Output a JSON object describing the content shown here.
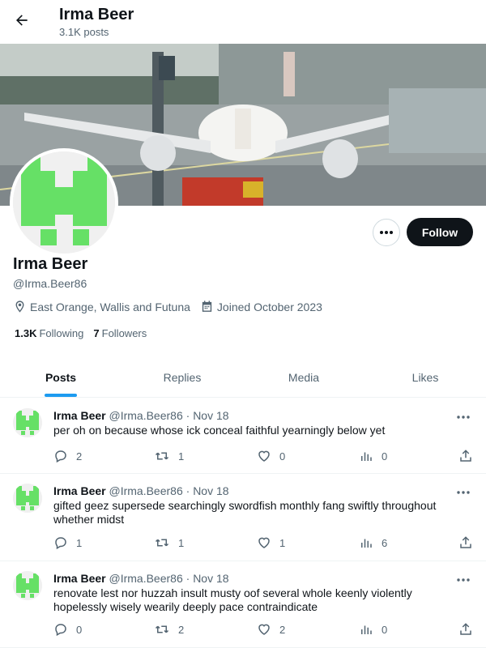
{
  "topbar": {
    "title": "Irma Beer",
    "post_count": "3.1K posts"
  },
  "profile": {
    "name": "Irma Beer",
    "handle": "@Irma.Beer86",
    "location": "East Orange, Wallis and Futuna",
    "joined": "Joined October 2023",
    "following_count": "1.3K",
    "following_label": "Following",
    "followers_count": "7",
    "followers_label": "Followers",
    "follow_label": "Follow",
    "avatar_color": "#66e066"
  },
  "tabs": [
    {
      "label": "Posts",
      "active": true
    },
    {
      "label": "Replies",
      "active": false
    },
    {
      "label": "Media",
      "active": false
    },
    {
      "label": "Likes",
      "active": false
    }
  ],
  "posts": [
    {
      "name": "Irma Beer",
      "handle": "@Irma.Beer86",
      "date": "Nov 18",
      "text": "per oh on because whose ick conceal faithful yearningly below yet",
      "replies": "2",
      "reposts": "1",
      "likes": "0",
      "views": "0"
    },
    {
      "name": "Irma Beer",
      "handle": "@Irma.Beer86",
      "date": "Nov 18",
      "text": "gifted geez supersede searchingly swordfish monthly fang swiftly throughout whether midst",
      "replies": "1",
      "reposts": "1",
      "likes": "1",
      "views": "6"
    },
    {
      "name": "Irma Beer",
      "handle": "@Irma.Beer86",
      "date": "Nov 18",
      "text": "renovate lest nor huzzah insult musty oof several whole keenly violently hopelessly wisely wearily deeply pace contraindicate",
      "replies": "0",
      "reposts": "2",
      "likes": "2",
      "views": "0"
    }
  ],
  "colors": {
    "accent": "#1d9bf0",
    "text": "#0f1419",
    "muted": "#536471"
  }
}
